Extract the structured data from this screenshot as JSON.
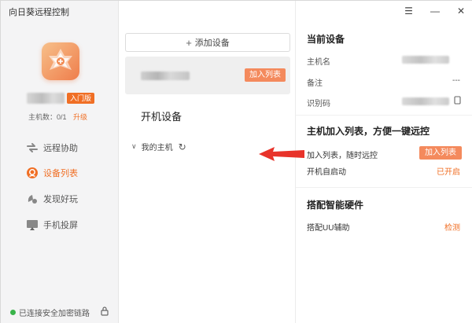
{
  "app": {
    "title": "向日葵远程控制"
  },
  "account": {
    "tier_badge": "入门版",
    "host_count": "主机数：0/1",
    "upgrade": "升级"
  },
  "nav": {
    "items": [
      {
        "label": "远程协助",
        "icon": "remote-assist-icon",
        "active": false
      },
      {
        "label": "设备列表",
        "icon": "device-list-icon",
        "active": true
      },
      {
        "label": "发现好玩",
        "icon": "discover-icon",
        "active": false
      },
      {
        "label": "手机投屏",
        "icon": "screen-cast-icon",
        "active": false
      }
    ]
  },
  "status": {
    "secure": "已连接安全加密链路"
  },
  "middle": {
    "add_device": "添加设备",
    "card_add_button": "加入列表",
    "boot_devices_title": "开机设备",
    "my_hosts": "我的主机"
  },
  "right": {
    "current_device_title": "当前设备",
    "hostname_label": "主机名",
    "note_label": "备注",
    "note_value": "---",
    "id_label": "识别码",
    "join_title": "主机加入列表，方便一键远控",
    "join_label": "加入列表，随时远控",
    "join_button": "加入列表",
    "autostart_label": "开机自启动",
    "autostart_value": "已开启",
    "hardware_title": "搭配智能硬件",
    "uu_label": "搭配UU辅助",
    "uu_value": "检测"
  },
  "colors": {
    "accent": "#f06f25",
    "button": "#f48a5d",
    "arrow": "#e8332a",
    "online": "#39b44a"
  }
}
